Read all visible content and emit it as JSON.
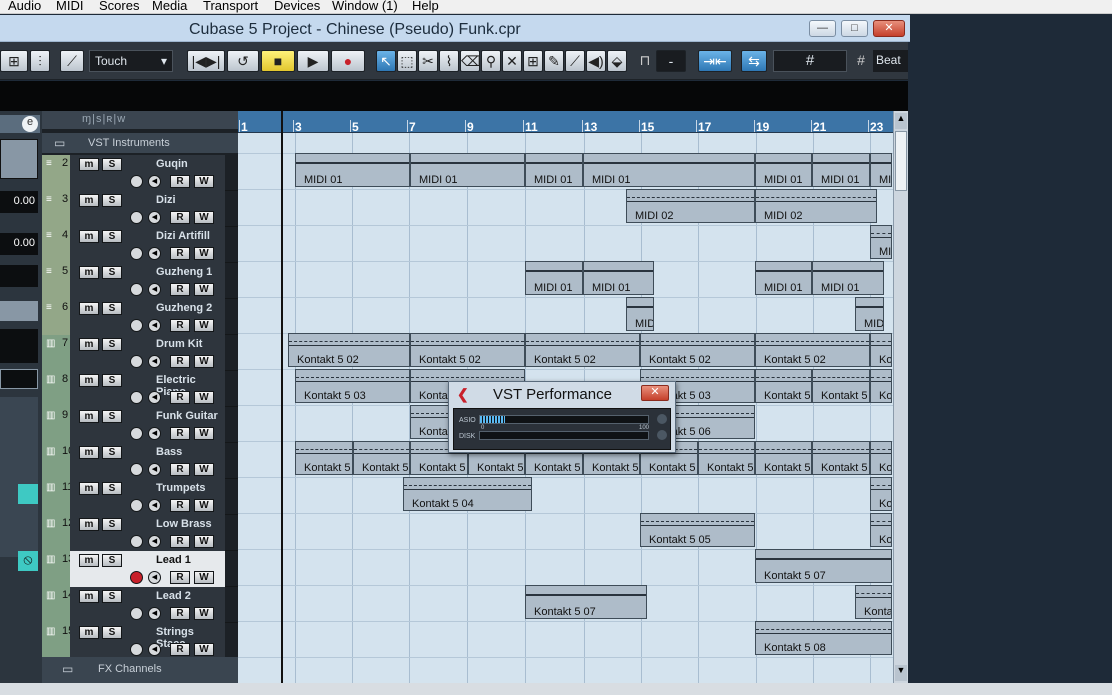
{
  "menu": [
    "Audio",
    "MIDI",
    "Scores",
    "Media",
    "Transport",
    "Devices",
    "Window (1)",
    "Help"
  ],
  "window": {
    "title": "Cubase 5 Project - Chinese (Pseudo) Funk.cpr",
    "min": "—",
    "max": "□",
    "close": "✕"
  },
  "toolbar": {
    "automation_mode": "Touch",
    "snap_value": "-",
    "grid": "#",
    "quantize_label": "Beat"
  },
  "inspector": {
    "values": [
      "0.00",
      "0.00"
    ]
  },
  "folder_name": "VST Instruments",
  "fx_channels": "FX Channels",
  "tracks": [
    {
      "num": "2",
      "name": "Guqin"
    },
    {
      "num": "3",
      "name": "Dizi"
    },
    {
      "num": "4",
      "name": "Dizi Artifill"
    },
    {
      "num": "5",
      "name": "Guzheng 1"
    },
    {
      "num": "6",
      "name": "Guzheng 2"
    },
    {
      "num": "7",
      "name": "Drum Kit"
    },
    {
      "num": "8",
      "name": "Electric Piano"
    },
    {
      "num": "9",
      "name": "Funk Guitar"
    },
    {
      "num": "10",
      "name": "Bass"
    },
    {
      "num": "11",
      "name": "Trumpets"
    },
    {
      "num": "12",
      "name": "Low Brass"
    },
    {
      "num": "13",
      "name": "Lead 1"
    },
    {
      "num": "14",
      "name": "Lead 2"
    },
    {
      "num": "15",
      "name": "Strings Stacc"
    }
  ],
  "ruler": [
    "1",
    "3",
    "5",
    "7",
    "9",
    "11",
    "13",
    "15",
    "17",
    "19",
    "21",
    "23"
  ],
  "parts": {
    "midi01": "MIDI 01",
    "midi02": "MIDI 02",
    "mid": "MIDI",
    "mi": "MI",
    "k502": "Kontakt 5 02",
    "k503": "Kontakt 5 03",
    "k5": "Kontakt 5",
    "k504": "Kontakt 5 04",
    "k505": "Kontakt 5 05",
    "k506": "Kontakt 5 06",
    "k507": "Kontakt 5 07",
    "k508": "Kontakt 5 08",
    "konta": "Konta",
    "ko": "Ko"
  },
  "vst": {
    "title": "VST Performance",
    "asio": "ASIO",
    "disk": "DISK",
    "scale_min": "0",
    "scale_max": "100",
    "asio_load": 0.15
  }
}
